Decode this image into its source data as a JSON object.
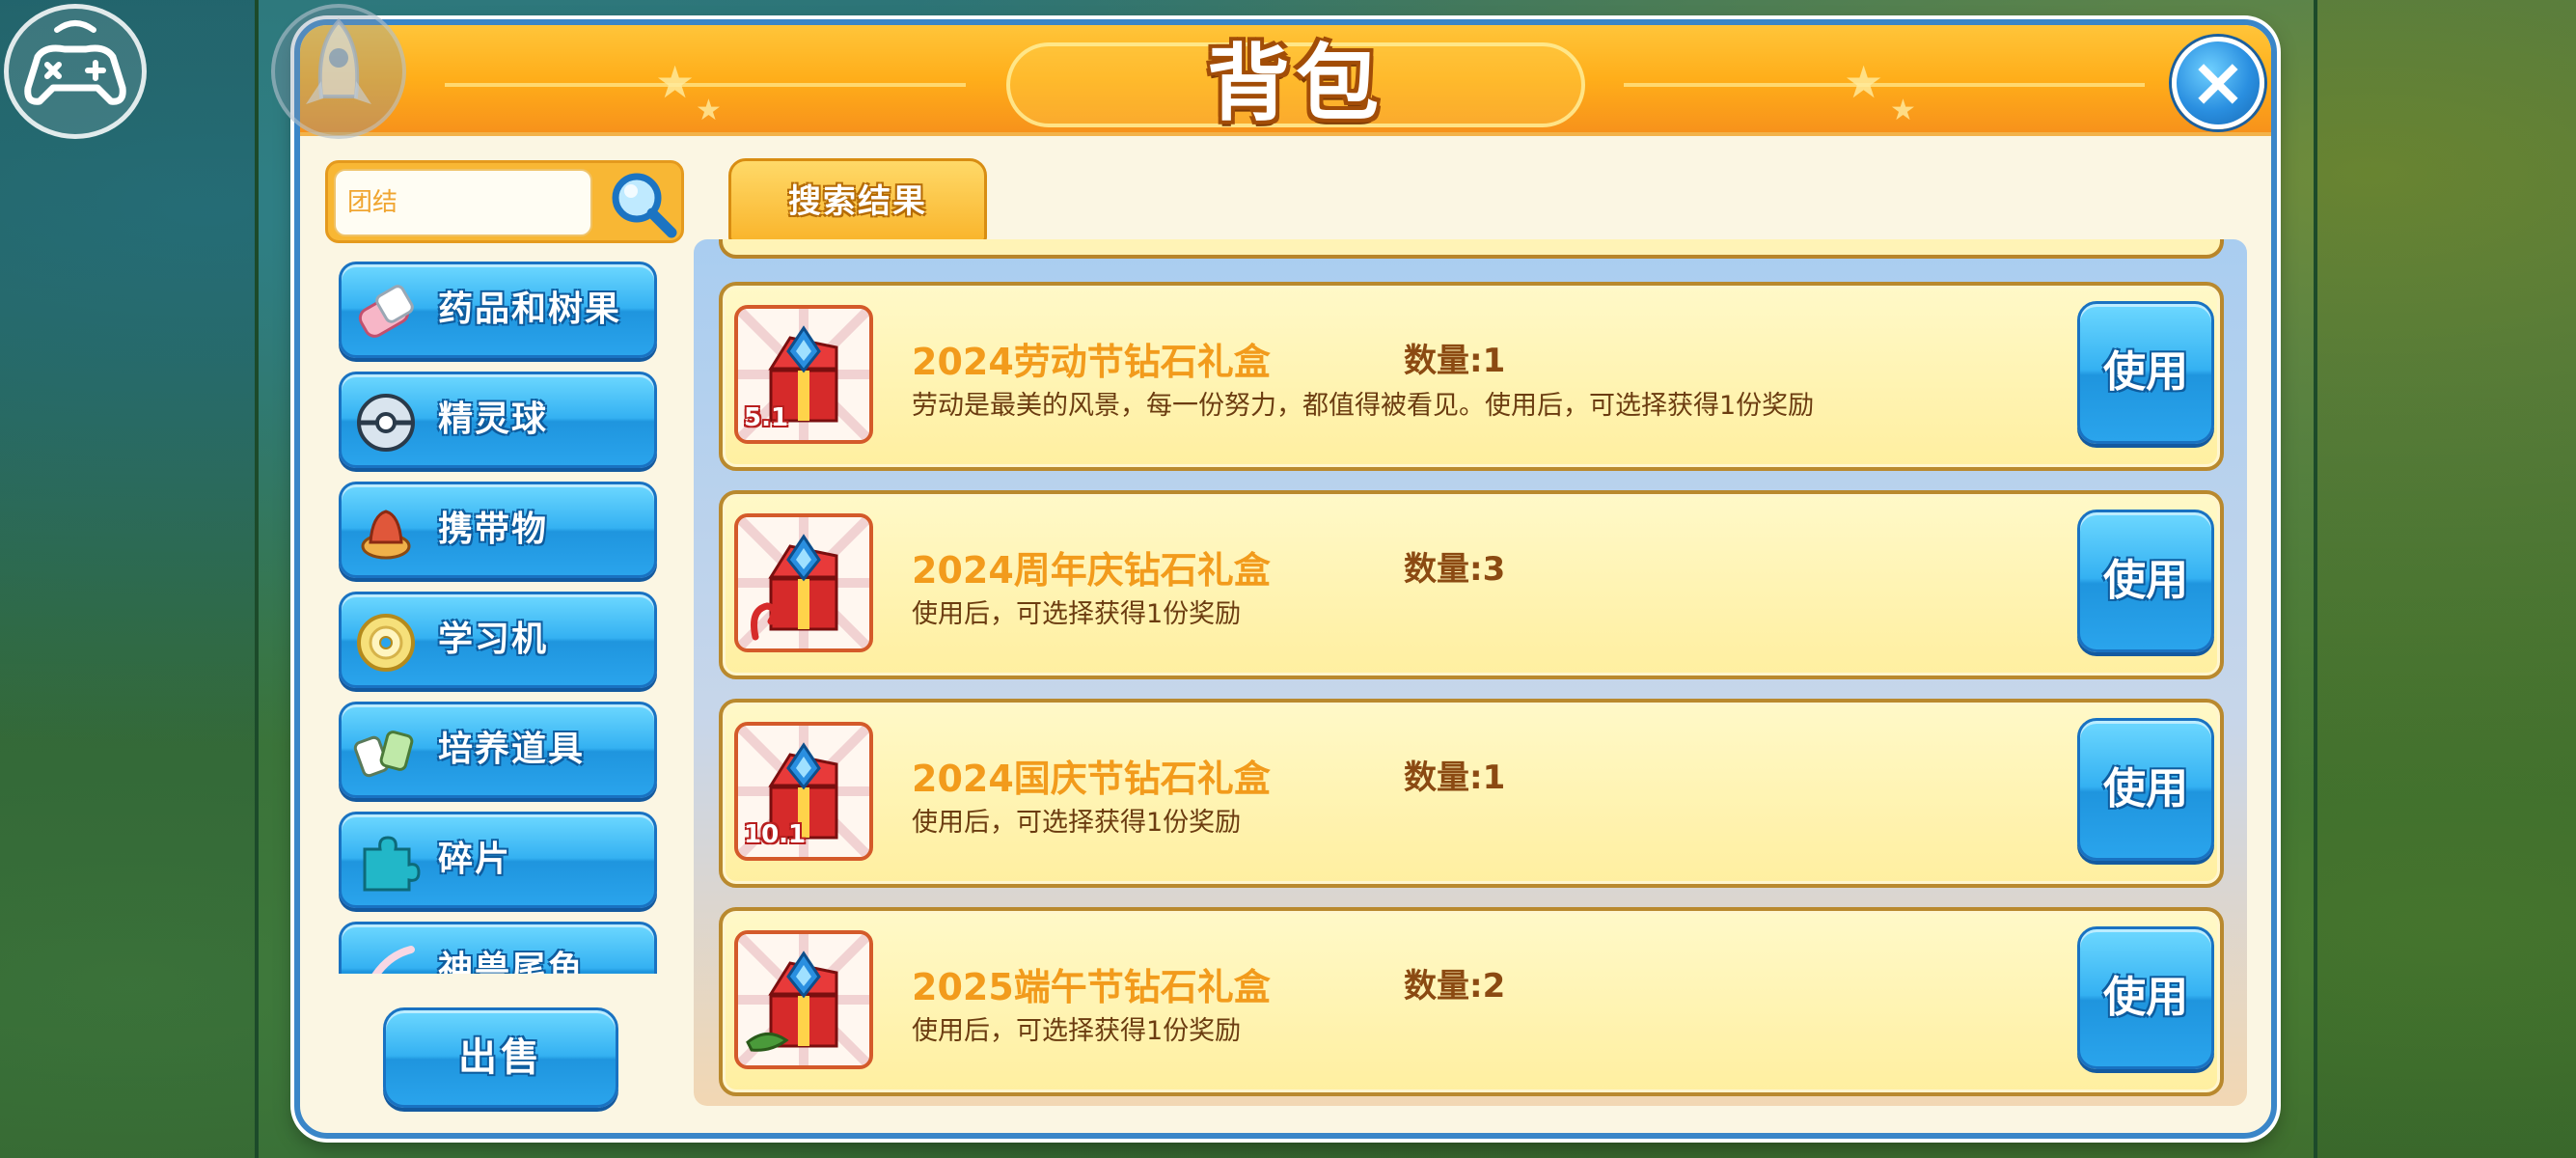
{
  "window": {
    "title": "背包",
    "close_label": "×"
  },
  "search": {
    "placeholder": "团结",
    "value": ""
  },
  "tab": {
    "label": "搜索结果"
  },
  "sidebar": {
    "items": [
      {
        "label": "药品和树果",
        "icon": "medicine-berry-icon"
      },
      {
        "label": "精灵球",
        "icon": "pokeball-icon"
      },
      {
        "label": "携带物",
        "icon": "held-item-icon"
      },
      {
        "label": "学习机",
        "icon": "disc-icon"
      },
      {
        "label": "培养道具",
        "icon": "training-item-icon"
      },
      {
        "label": "碎片",
        "icon": "puzzle-piece-icon"
      },
      {
        "label": "神兽尾鱼",
        "icon": "legendary-icon"
      }
    ],
    "sell_label": "出售"
  },
  "items": [
    {
      "name": "2024劳动节钻石礼盒",
      "qty": "数量:1",
      "desc": "劳动是最美的风景，每一份努力，都值得被看见。使用后，可选择获得1份奖励",
      "use_label": "使用",
      "badge": "5.1"
    },
    {
      "name": "2024周年庆钻石礼盒",
      "qty": "数量:3",
      "desc": "使用后，可选择获得1份奖励",
      "use_label": "使用",
      "badge": ""
    },
    {
      "name": "2024国庆节钻石礼盒",
      "qty": "数量:1",
      "desc": "使用后，可选择获得1份奖励",
      "use_label": "使用",
      "badge": "10.1"
    },
    {
      "name": "2025端午节钻石礼盒",
      "qty": "数量:2",
      "desc": "使用后，可选择获得1份奖励",
      "use_label": "使用",
      "badge": ""
    }
  ],
  "colors": {
    "header": "#ffae1a",
    "panel_border": "#3a86c8",
    "button_blue": "#2aa4ec",
    "item_name": "#f29b1c",
    "item_bg": "#fff3b6"
  }
}
